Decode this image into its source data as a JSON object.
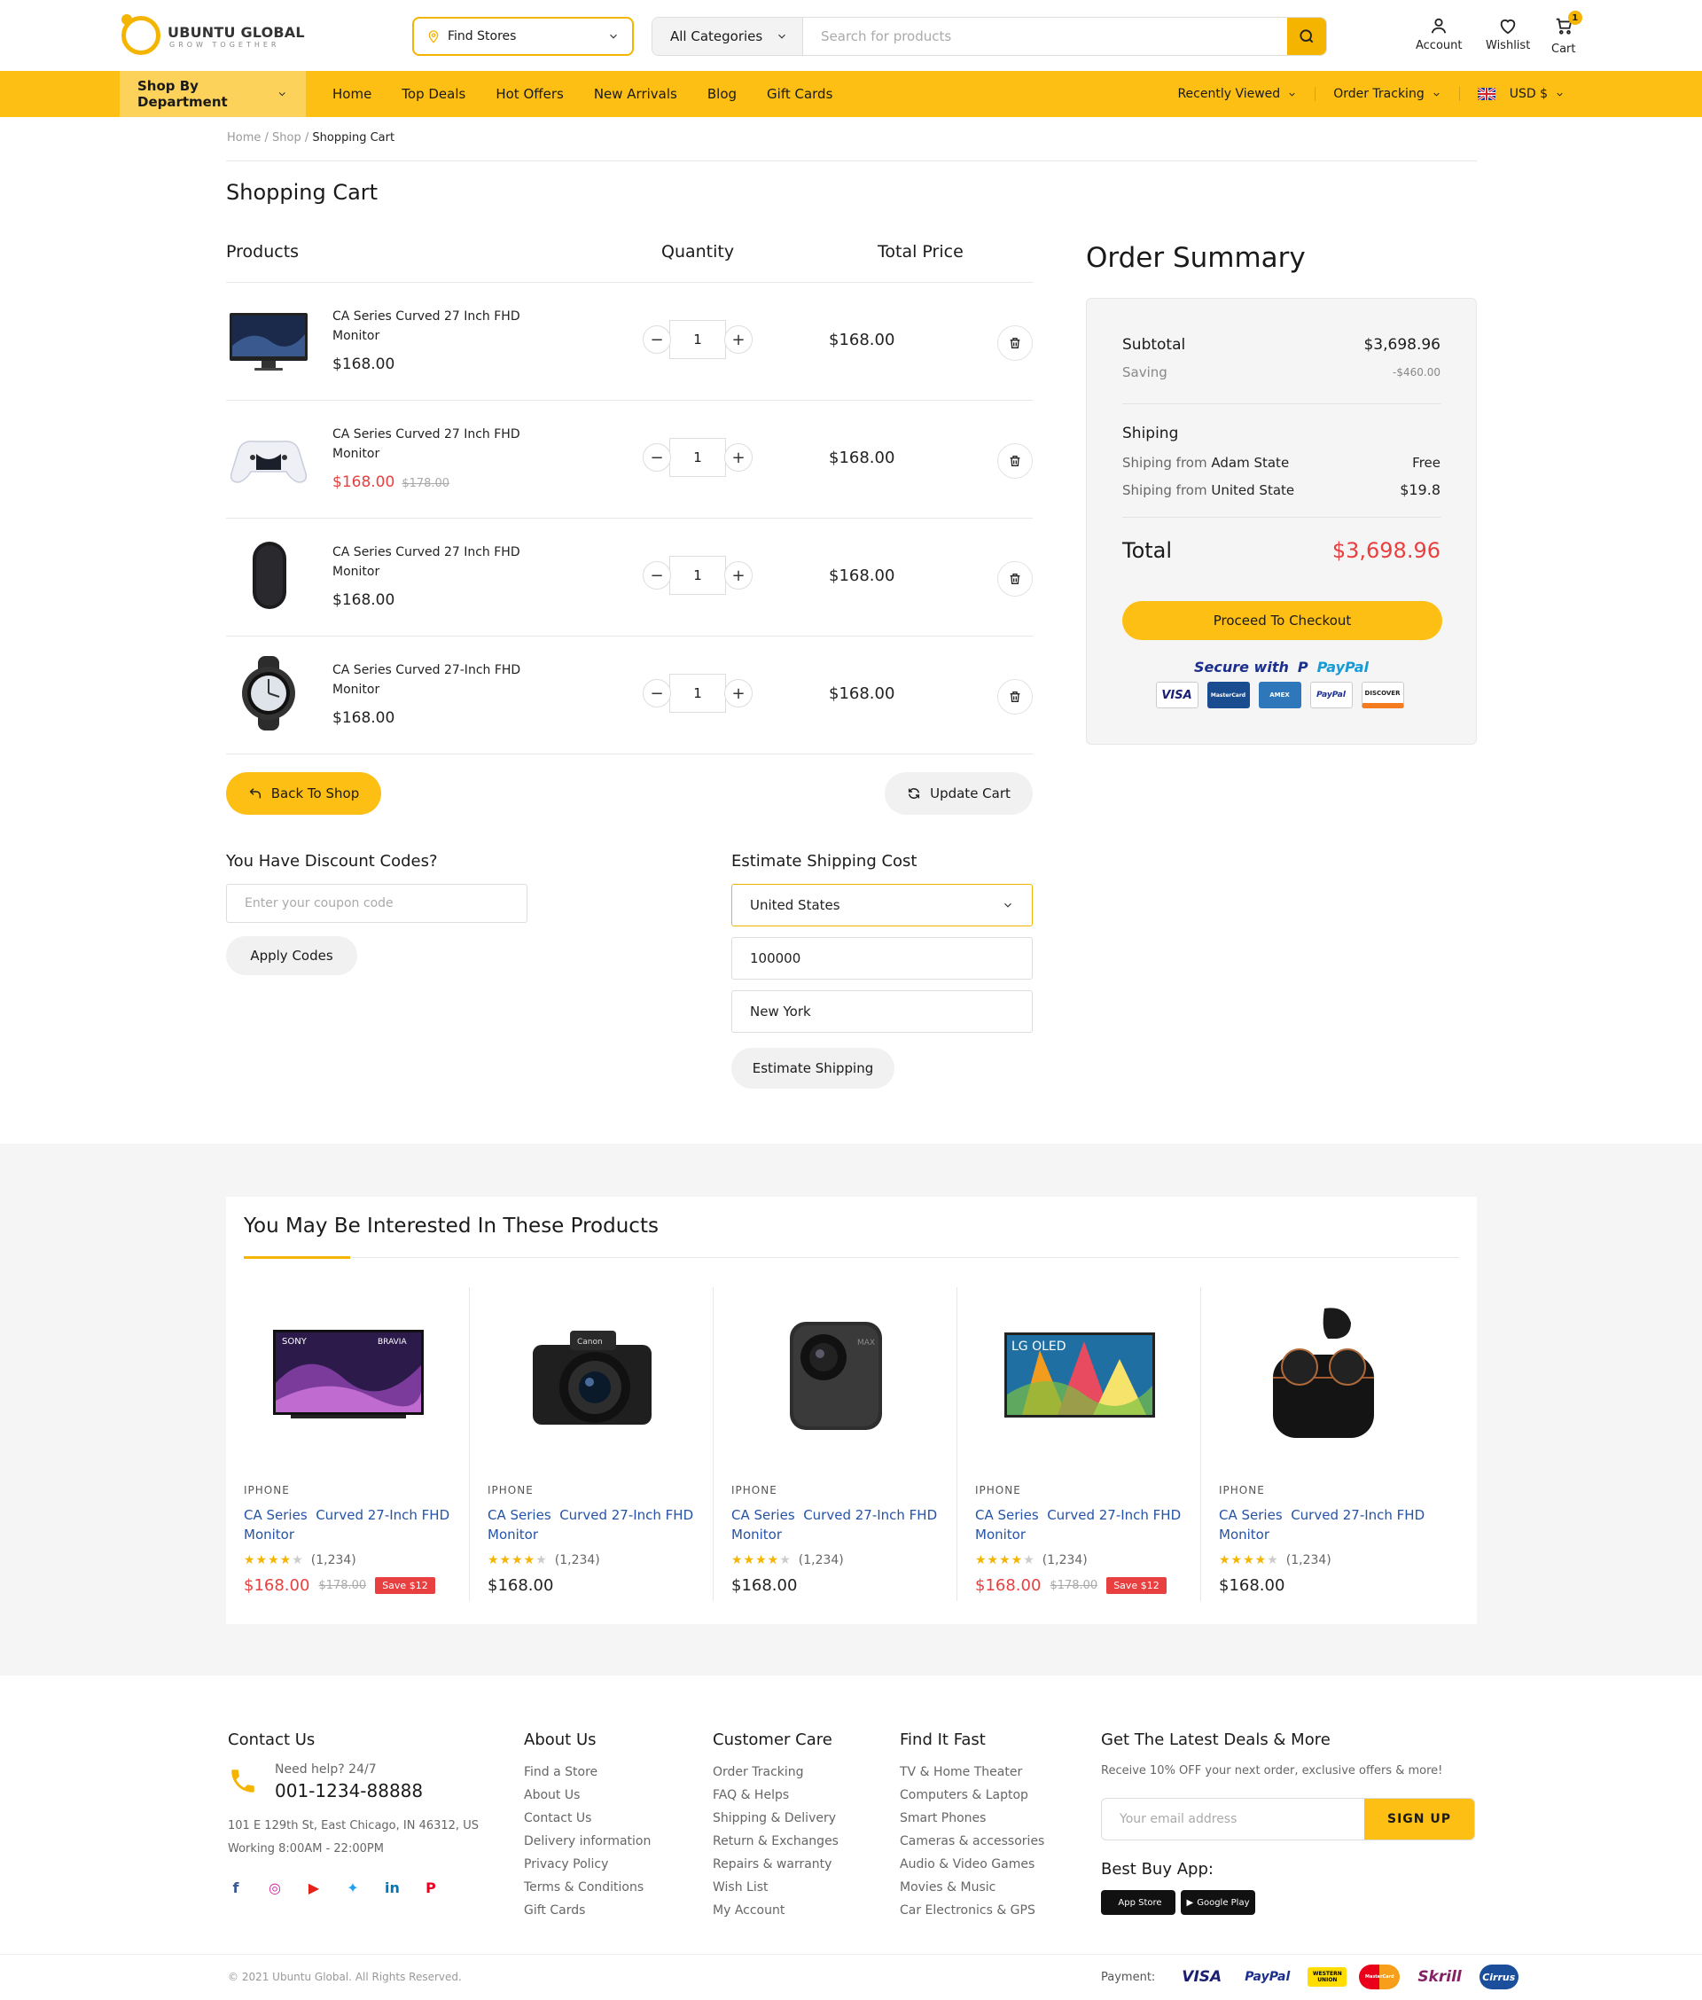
{
  "header": {
    "logo_name": "UBUNTU GLOBAL",
    "logo_tagline": "GROW TOGETHER",
    "find_stores": "Find Stores",
    "category": "All Categories",
    "search_placeholder": "Search for products",
    "account": "Account",
    "wishlist": "Wishlist",
    "cart": "Cart",
    "cart_count": "1"
  },
  "nav": {
    "department": "Shop By Department",
    "links": [
      "Home",
      "Top Deals",
      "Hot Offers",
      "New Arrivals",
      "Blog",
      "Gift Cards"
    ],
    "recently_viewed": "Recently Viewed",
    "order_tracking": "Order Tracking",
    "currency": "USD $"
  },
  "breadcrumb": {
    "home": "Home",
    "shop": "Shop",
    "current": "Shopping Cart"
  },
  "page_title": "Shopping Cart",
  "cart": {
    "headers": {
      "products": "Products",
      "quantity": "Quantity",
      "total": "Total Price"
    },
    "items": [
      {
        "name": "CA Series Curved 27 Inch FHD Monitor",
        "price": "$168.00",
        "old_price": "",
        "qty": "1",
        "total": "$168.00",
        "icon": "imac-icon"
      },
      {
        "name": "CA Series Curved 27 Inch FHD Monitor",
        "price": "$168.00",
        "old_price": "$178.00",
        "qty": "1",
        "total": "$168.00",
        "icon": "gamepad-icon"
      },
      {
        "name": "CA Series Curved 27 Inch FHD Monitor",
        "price": "$168.00",
        "old_price": "",
        "qty": "1",
        "total": "$168.00",
        "icon": "mouse-icon"
      },
      {
        "name": "CA Series Curved 27-Inch FHD Monitor",
        "price": "$168.00",
        "old_price": "",
        "qty": "1",
        "total": "$168.00",
        "icon": "watch-icon"
      }
    ],
    "back_to_shop": "Back To Shop",
    "update_cart": "Update Cart"
  },
  "discount": {
    "title": "You Have Discount Codes?",
    "placeholder": "Enter your coupon code",
    "button": "Apply Codes"
  },
  "shipping_estimate": {
    "title": "Estimate Shipping Cost",
    "country": "United States",
    "zip": "100000",
    "city": "New York",
    "button": "Estimate Shipping"
  },
  "summary": {
    "title": "Order Summary",
    "subtotal_label": "Subtotal",
    "subtotal": "$3,698.96",
    "saving_label": "Saving",
    "saving": "-$460.00",
    "shipping_label": "Shiping",
    "ship1_label": "Shiping from",
    "ship1_place": "Adam State",
    "ship1_value": "Free",
    "ship2_label": "Shiping from",
    "ship2_place": "United State",
    "ship2_value": "$19.8",
    "total_label": "Total",
    "total": "$3,698.96",
    "checkout": "Proceed To Checkout",
    "secure": "Secure with",
    "paypal": "PayPal",
    "cards": [
      "VISA",
      "MasterCard",
      "AMEX",
      "PayPal",
      "DISCOVER"
    ]
  },
  "interest": {
    "title": "You May Be Interested In These Products",
    "products": [
      {
        "category": "IPHONE",
        "brand": "CA Series",
        "name": "Curved 27-Inch FHD Monitor",
        "rating": "(1,234)",
        "price": "$168.00",
        "old_price": "$178.00",
        "save": "Save $12",
        "icon": "tv-icon",
        "screen_text": "SONY",
        "screen_sub": "BRAVIA"
      },
      {
        "category": "IPHONE",
        "brand": "CA Series",
        "name": "Curved 27-Inch FHD Monitor",
        "rating": "(1,234)",
        "price": "$168.00",
        "old_price": "",
        "save": "",
        "icon": "camera-icon",
        "screen_text": "Canon"
      },
      {
        "category": "IPHONE",
        "brand": "CA Series",
        "name": "Curved 27-Inch FHD Monitor",
        "rating": "(1,234)",
        "price": "$168.00",
        "old_price": "",
        "save": "",
        "icon": "action-camera-icon",
        "screen_text": "MAX"
      },
      {
        "category": "IPHONE",
        "brand": "CA Series",
        "name": "Curved 27-Inch FHD Monitor",
        "rating": "(1,234)",
        "price": "$168.00",
        "old_price": "$178.00",
        "save": "Save $12",
        "icon": "oled-tv-icon",
        "screen_text": "LG OLED"
      },
      {
        "category": "IPHONE",
        "brand": "CA Series",
        "name": "Curved 27-Inch FHD Monitor",
        "rating": "(1,234)",
        "price": "$168.00",
        "old_price": "",
        "save": "",
        "icon": "earbuds-icon"
      }
    ]
  },
  "footer": {
    "contact_title": "Contact Us",
    "help": "Need help? 24/7",
    "phone": "001-1234-88888",
    "address": "101 E 129th St, East Chicago, IN 46312, US",
    "hours": "Working 8:00AM - 22:00PM",
    "about_title": "About Us",
    "about_links": [
      "Find a Store",
      "About Us",
      "Contact Us",
      "Delivery information",
      "Privacy Policy",
      "Terms & Conditions",
      "Gift Cards"
    ],
    "care_title": "Customer Care",
    "care_links": [
      "Order Tracking",
      "FAQ & Helps",
      "Shipping & Delivery",
      "Return & Exchanges",
      "Repairs & warranty",
      "Wish List",
      "My Account"
    ],
    "find_title": "Find It Fast",
    "find_links": [
      "TV & Home Theater",
      "Computers & Laptop",
      "Smart Phones",
      "Cameras & accessories",
      "Audio & Video Games",
      "Movies & Music",
      "Car Electronics & GPS"
    ],
    "deals_title": "Get The Latest Deals & More",
    "deals_text": "Receive 10% OFF your next order, exclusive offers & more!",
    "email_placeholder": "Your email address",
    "signup": "SIGN UP",
    "app_title": "Best Buy App:",
    "app_store": "App Store",
    "google_play": "Google Play",
    "copyright": "© 2021 Ubuntu Global. All Rights Reserved.",
    "payment_label": "Payment:",
    "payments": [
      "VISA",
      "PayPal",
      "WESTERN UNION",
      "MasterCard",
      "Skrill",
      "Cirrus"
    ]
  },
  "colors": {
    "accent": "#fdbf13",
    "sale": "#e84040",
    "link": "#2553a8"
  }
}
